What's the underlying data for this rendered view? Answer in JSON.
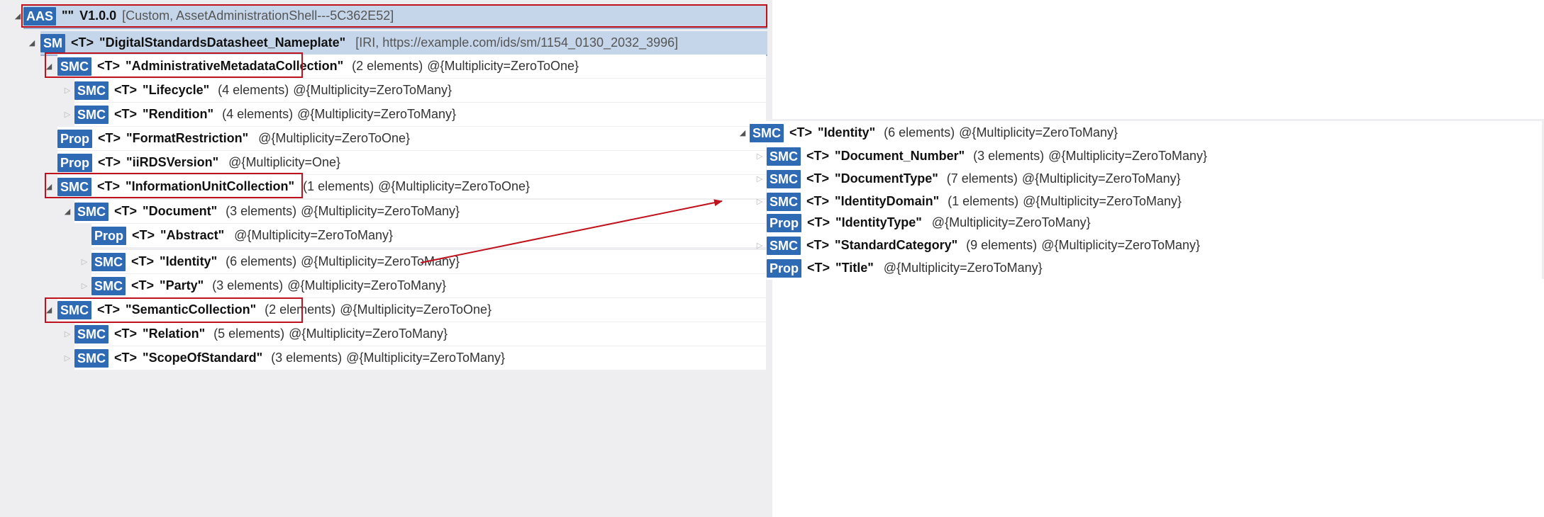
{
  "colors": {
    "badge": "#2f6bb4",
    "highlight": "#c6d6ea",
    "annotation": "#c0121c"
  },
  "left_tree": [
    {
      "exp": "expanded",
      "badge": "AAS",
      "t": "",
      "name": "\"\"",
      "version": "V1.0.0",
      "extra": "[Custom, AssetAdministrationShell---5C362E52]"
    },
    {
      "exp": "expanded",
      "badge": "SM",
      "t": "<T>",
      "name": "\"DigitalStandardsDatasheet_Nameplate\"",
      "extra": "[IRI, https://example.com/ids/sm/1154_0130_2032_3996]"
    },
    {
      "exp": "expanded",
      "badge": "SMC",
      "t": "<T>",
      "name": "\"AdministrativeMetadataCollection\"",
      "count": "(2 elements)",
      "mult": "@{Multiplicity=ZeroToOne}"
    },
    {
      "exp": "collapsed",
      "badge": "SMC",
      "t": "<T>",
      "name": "\"Lifecycle\"",
      "count": "(4 elements)",
      "mult": "@{Multiplicity=ZeroToMany}"
    },
    {
      "exp": "collapsed",
      "badge": "SMC",
      "t": "<T>",
      "name": "\"Rendition\"",
      "count": "(4 elements)",
      "mult": "@{Multiplicity=ZeroToMany}"
    },
    {
      "exp": "none",
      "badge": "Prop",
      "t": "<T>",
      "name": "\"FormatRestriction\"",
      "count": "",
      "mult": "@{Multiplicity=ZeroToOne}"
    },
    {
      "exp": "none",
      "badge": "Prop",
      "t": "<T>",
      "name": "\"iiRDSVersion\"",
      "count": "",
      "mult": "@{Multiplicity=One}"
    },
    {
      "exp": "expanded",
      "badge": "SMC",
      "t": "<T>",
      "name": "\"InformationUnitCollection\"",
      "count": "(1 elements)",
      "mult": "@{Multiplicity=ZeroToOne}"
    },
    {
      "exp": "expanded",
      "badge": "SMC",
      "t": "<T>",
      "name": "\"Document\"",
      "count": "(3 elements)",
      "mult": "@{Multiplicity=ZeroToMany}"
    },
    {
      "exp": "none",
      "badge": "Prop",
      "t": "<T>",
      "name": "\"Abstract\"",
      "count": "",
      "mult": "@{Multiplicity=ZeroToMany}"
    },
    {
      "exp": "collapsed",
      "badge": "SMC",
      "t": "<T>",
      "name": "\"Identity\"",
      "count": "(6 elements)",
      "mult": "@{Multiplicity=ZeroToMany}"
    },
    {
      "exp": "collapsed",
      "badge": "SMC",
      "t": "<T>",
      "name": "\"Party\"",
      "count": "(3 elements)",
      "mult": "@{Multiplicity=ZeroToMany}"
    },
    {
      "exp": "expanded",
      "badge": "SMC",
      "t": "<T>",
      "name": "\"SemanticCollection\"",
      "count": "(2 elements)",
      "mult": "@{Multiplicity=ZeroToOne}"
    },
    {
      "exp": "collapsed",
      "badge": "SMC",
      "t": "<T>",
      "name": "\"Relation\"",
      "count": "(5 elements)",
      "mult": "@{Multiplicity=ZeroToMany}"
    },
    {
      "exp": "collapsed",
      "badge": "SMC",
      "t": "<T>",
      "name": "\"ScopeOfStandard\"",
      "count": "(3 elements)",
      "mult": "@{Multiplicity=ZeroToMany}"
    }
  ],
  "right_tree": [
    {
      "exp": "expanded",
      "badge": "SMC",
      "t": "<T>",
      "name": "\"Identity\"",
      "count": "(6 elements)",
      "mult": "@{Multiplicity=ZeroToMany}"
    },
    {
      "exp": "collapsed",
      "badge": "SMC",
      "t": "<T>",
      "name": "\"Document_Number\"",
      "count": "(3 elements)",
      "mult": "@{Multiplicity=ZeroToMany}"
    },
    {
      "exp": "collapsed",
      "badge": "SMC",
      "t": "<T>",
      "name": "\"DocumentType\"",
      "count": "(7 elements)",
      "mult": "@{Multiplicity=ZeroToMany}"
    },
    {
      "exp": "collapsed",
      "badge": "SMC",
      "t": "<T>",
      "name": "\"IdentityDomain\"",
      "count": "(1 elements)",
      "mult": "@{Multiplicity=ZeroToMany}"
    },
    {
      "exp": "none",
      "badge": "Prop",
      "t": "<T>",
      "name": "\"IdentityType\"",
      "count": "",
      "mult": "@{Multiplicity=ZeroToMany}"
    },
    {
      "exp": "collapsed",
      "badge": "SMC",
      "t": "<T>",
      "name": "\"StandardCategory\"",
      "count": "(9 elements)",
      "mult": "@{Multiplicity=ZeroToMany}"
    },
    {
      "exp": "none",
      "badge": "Prop",
      "t": "<T>",
      "name": "\"Title\"",
      "count": "",
      "mult": "@{Multiplicity=ZeroToMany}"
    }
  ]
}
